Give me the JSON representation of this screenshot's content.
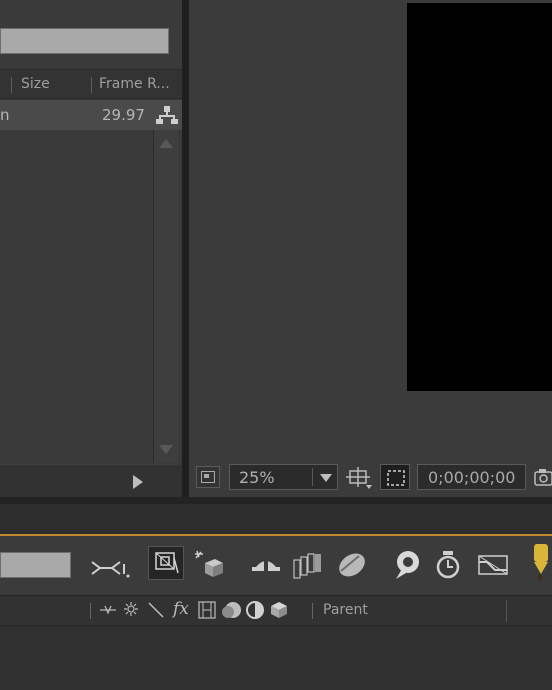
{
  "project": {
    "columns": [
      "Size",
      "Frame R..."
    ],
    "item": {
      "name_fragment": "n",
      "frame_rate": "29.97"
    }
  },
  "viewer": {
    "zoom": "25%",
    "timecode": "0;00;00;00"
  },
  "timeline": {
    "parent_label": "Parent"
  },
  "colors": {
    "panel": "#3b3b3b",
    "accent": "#c58a2e",
    "search_field": "#a9a9a9",
    "playhead": "#d9b53a"
  }
}
